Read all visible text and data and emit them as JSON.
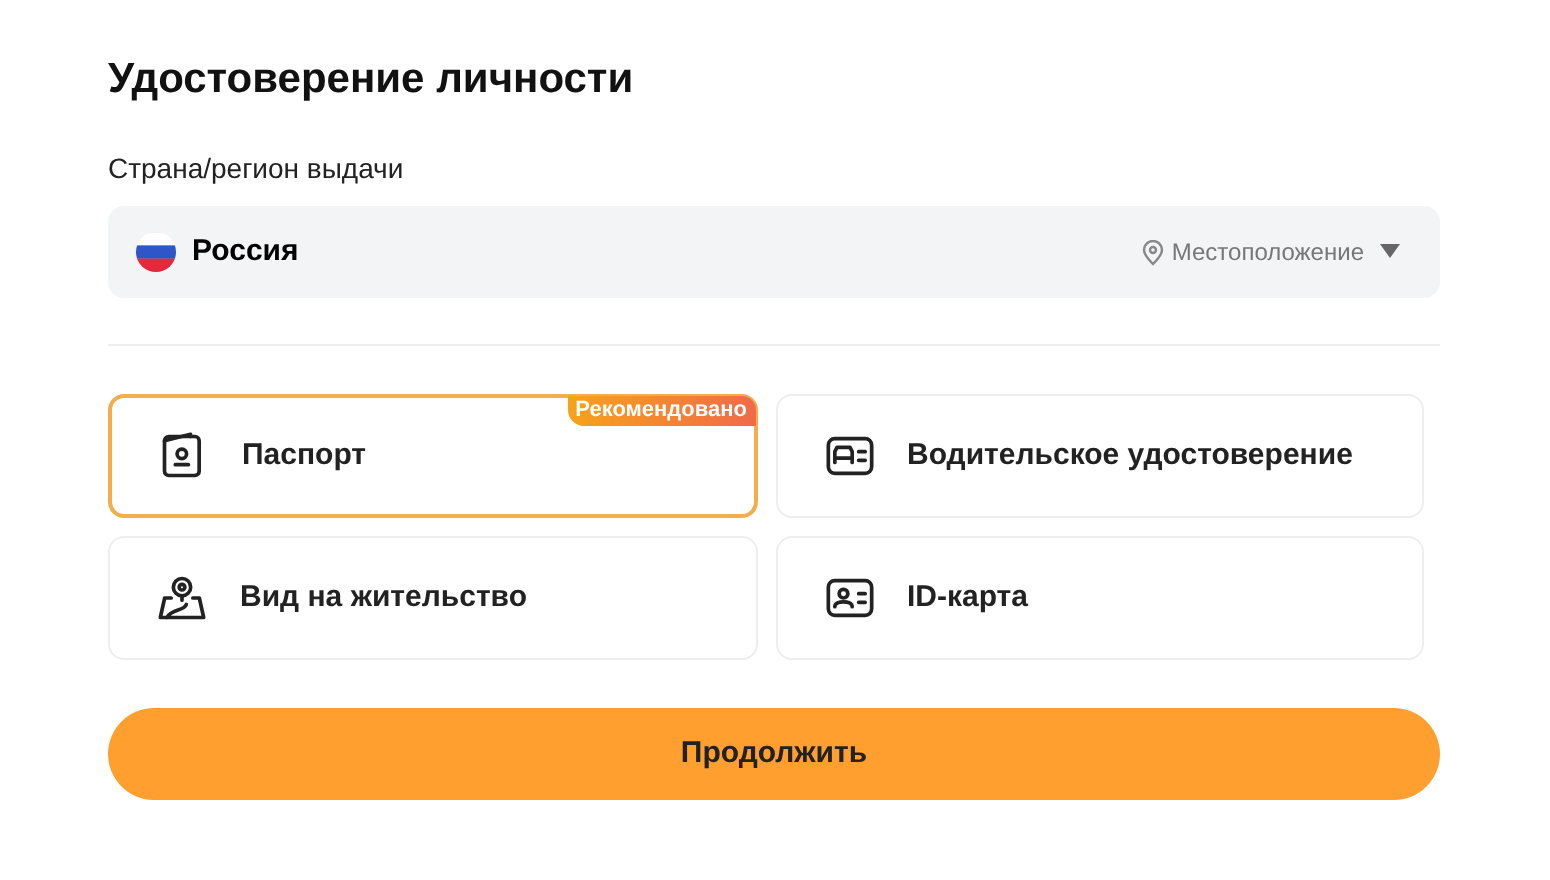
{
  "title": "Удостоверение личности",
  "country": {
    "label": "Страна/регион выдачи",
    "value": "Россия",
    "location": "Местоположение"
  },
  "documents": [
    {
      "kind": "passport",
      "label": "Паспорт",
      "selected": true,
      "badge": "Рекомендовано"
    },
    {
      "kind": "license",
      "label": "Водительское удостоверение",
      "selected": false
    },
    {
      "kind": "residence",
      "label": "Вид на жительство",
      "selected": false
    },
    {
      "kind": "idcard",
      "label": "ID-карта",
      "selected": false
    }
  ],
  "continue_button": "Продолжить"
}
